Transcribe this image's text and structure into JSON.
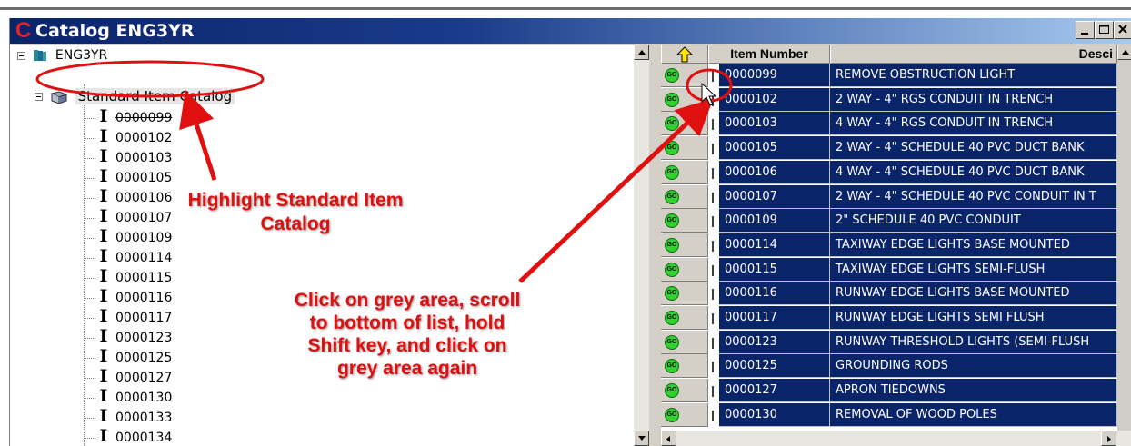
{
  "window": {
    "title": "Catalog ENG3YR",
    "app_icon": "C"
  },
  "tree": {
    "root_label": "ENG3YR",
    "catalog_label": "Standard Item Catalog",
    "item_icon": "I",
    "items": [
      "0000099",
      "0000102",
      "0000103",
      "0000105",
      "0000106",
      "0000107",
      "0000109",
      "0000114",
      "0000115",
      "0000116",
      "0000117",
      "0000123",
      "0000125",
      "0000127",
      "0000130",
      "0000133",
      "0000134"
    ]
  },
  "grid": {
    "headers": {
      "number": "Item Number",
      "description": "Desci"
    },
    "go_icon_label": "GO",
    "rows": [
      {
        "number": "0000099",
        "description": "REMOVE OBSTRUCTION LIGHT"
      },
      {
        "number": "0000102",
        "description": "2 WAY - 4\" RGS CONDUIT IN TRENCH"
      },
      {
        "number": "0000103",
        "description": "4 WAY - 4\" RGS CONDUIT IN TRENCH"
      },
      {
        "number": "0000105",
        "description": "2 WAY - 4\" SCHEDULE 40 PVC DUCT BANK"
      },
      {
        "number": "0000106",
        "description": "4 WAY - 4\" SCHEDULE 40 PVC DUCT BANK"
      },
      {
        "number": "0000107",
        "description": "2 WAY - 4\" SCHEDULE 40 PVC CONDUIT IN T"
      },
      {
        "number": "0000109",
        "description": "2\" SCHEDULE 40 PVC CONDUIT"
      },
      {
        "number": "0000114",
        "description": "TAXIWAY EDGE LIGHTS BASE MOUNTED"
      },
      {
        "number": "0000115",
        "description": "TAXIWAY EDGE LIGHTS SEMI-FLUSH"
      },
      {
        "number": "0000116",
        "description": "RUNWAY EDGE LIGHTS BASE MOUNTED"
      },
      {
        "number": "0000117",
        "description": "RUNWAY EDGE LIGHTS SEMI FLUSH"
      },
      {
        "number": "0000123",
        "description": "RUNWAY THRESHOLD LIGHTS (SEMI-FLUSH"
      },
      {
        "number": "0000125",
        "description": "GROUNDING RODS"
      },
      {
        "number": "0000127",
        "description": "APRON TIEDOWNS"
      },
      {
        "number": "0000130",
        "description": "REMOVAL OF WOOD POLES"
      }
    ]
  },
  "annotations": {
    "highlight": "Highlight Standard Item Catalog",
    "click": "Click on grey area, scroll to bottom of list, hold Shift key, and click on grey area again"
  },
  "colors": {
    "selection": "#0a246a",
    "annotation": "#e01010",
    "go_icon": "#2fd02f",
    "title_bar": "#0a246a"
  }
}
